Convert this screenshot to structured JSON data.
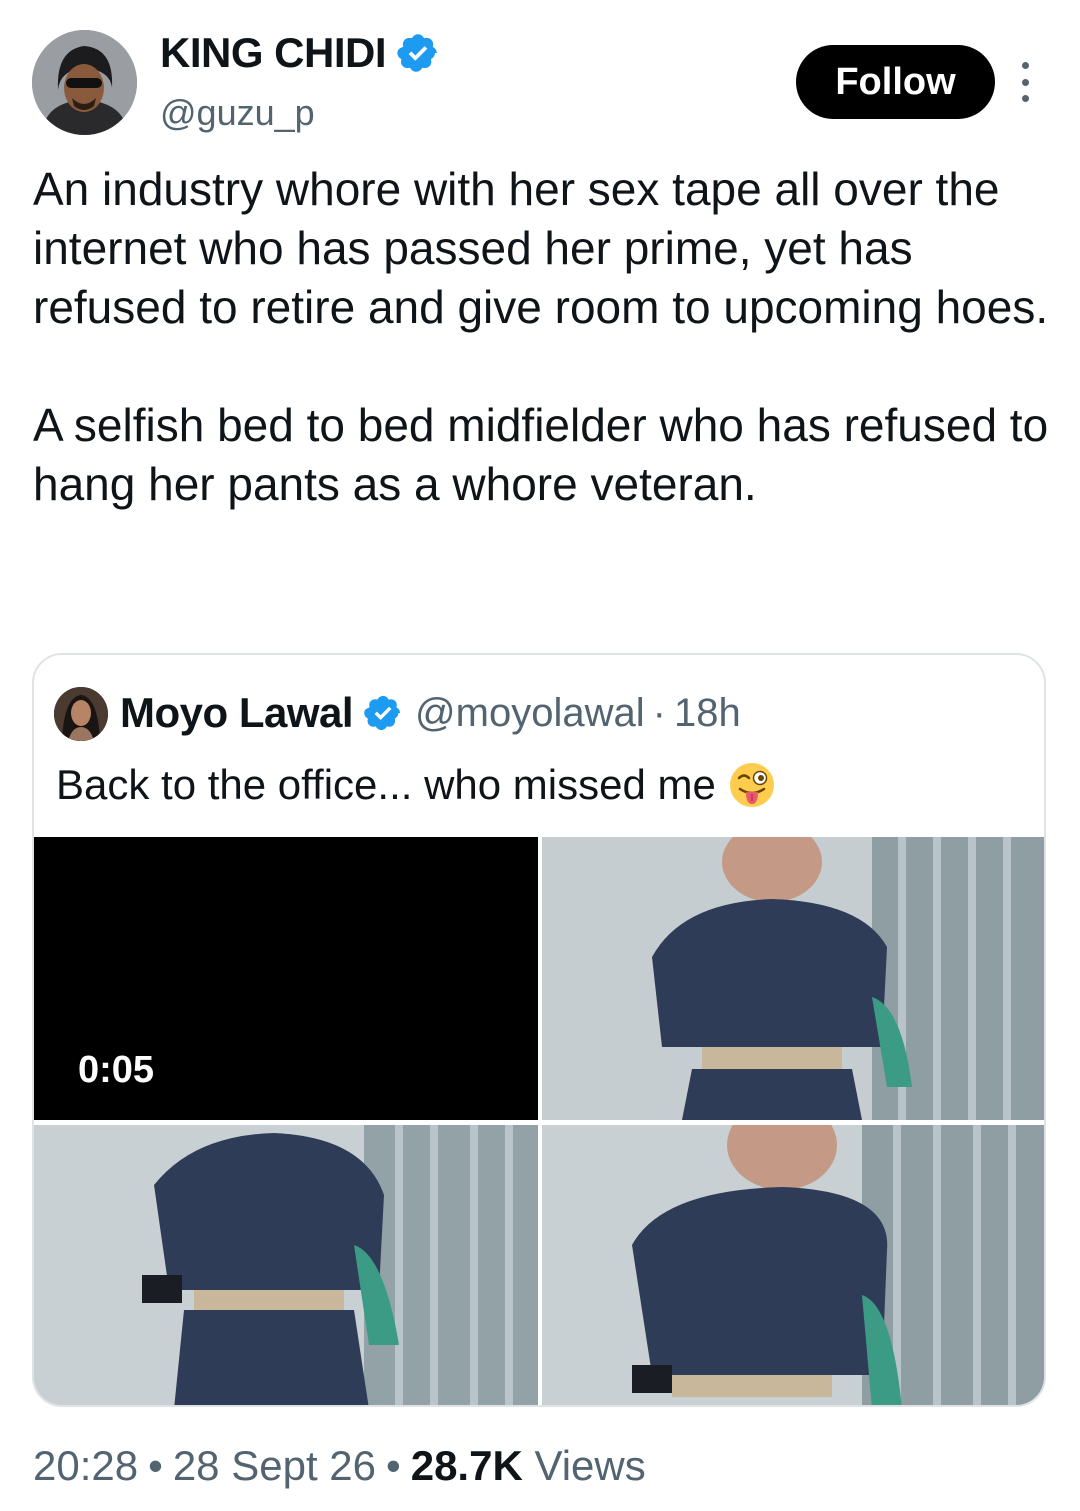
{
  "author": {
    "name": "KING CHIDI",
    "handle": "@guzu_p",
    "verified_color": "#1d9bf0"
  },
  "follow_label": "Follow",
  "tweet": {
    "paragraphs": [
      "An industry whore with her sex tape all over the internet who has passed her prime, yet has refused to retire and give room to upcoming hoes.",
      "A selfish bed to bed midfielder who has refused to hang her pants as a whore veteran."
    ]
  },
  "quote": {
    "name": "Moyo Lawal",
    "handle": "@moyolawal",
    "separator": "·",
    "time": "18h",
    "text": "Back to the office... who missed me",
    "emoji": "winking-face-with-tongue",
    "video_duration": "0:05"
  },
  "meta": {
    "time": "20:28",
    "date": "28 Sept 26",
    "views_count": "28.7K",
    "views_label": "Views",
    "separator": "•"
  },
  "colors": {
    "text_primary": "#0f1419",
    "text_secondary": "#536471",
    "border": "#dfe3e6",
    "verified": "#1d9bf0"
  }
}
